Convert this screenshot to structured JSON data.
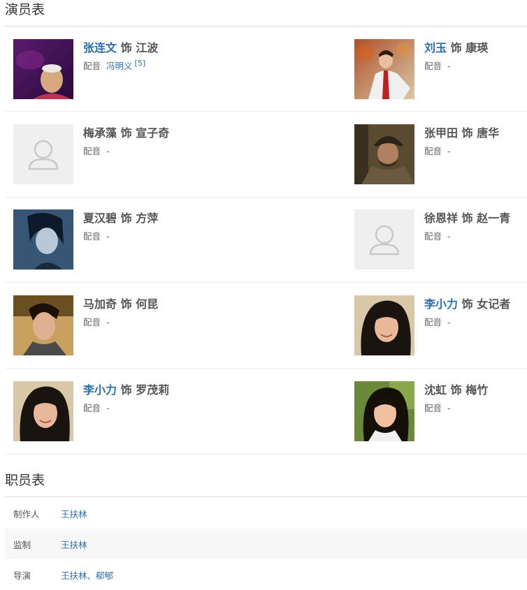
{
  "cast": {
    "title": "演员表",
    "voice_label": "配音",
    "role_sep": "饰",
    "members": [
      {
        "actor": "张连文",
        "role": "江波",
        "actor_link": true,
        "voice": "冯明义",
        "voice_link": true,
        "ref": "[5]",
        "photo": "photo"
      },
      {
        "actor": "刘玉",
        "role": "康瑛",
        "actor_link": true,
        "voice": "-",
        "voice_link": false,
        "ref": "",
        "photo": "photo"
      },
      {
        "actor": "梅承藻",
        "role": "宣子奇",
        "actor_link": false,
        "voice": "-",
        "voice_link": false,
        "ref": "",
        "photo": "placeholder-person-icon"
      },
      {
        "actor": "张甲田",
        "role": "唐华",
        "actor_link": false,
        "voice": "-",
        "voice_link": false,
        "ref": "",
        "photo": "photo"
      },
      {
        "actor": "夏汉碧",
        "role": "方萍",
        "actor_link": false,
        "voice": "-",
        "voice_link": false,
        "ref": "",
        "photo": "photo"
      },
      {
        "actor": "徐恩祥",
        "role": "赵一青",
        "actor_link": false,
        "voice": "-",
        "voice_link": false,
        "ref": "",
        "photo": "placeholder-person-icon"
      },
      {
        "actor": "马加奇",
        "role": "何昆",
        "actor_link": false,
        "voice": "-",
        "voice_link": false,
        "ref": "",
        "photo": "photo"
      },
      {
        "actor": "李小力",
        "role": "女记者",
        "actor_link": true,
        "voice": "-",
        "voice_link": false,
        "ref": "",
        "photo": "photo"
      },
      {
        "actor": "李小力",
        "role": "罗茂莉",
        "actor_link": true,
        "voice": "-",
        "voice_link": false,
        "ref": "",
        "photo": "photo"
      },
      {
        "actor": "沈虹",
        "role": "梅竹",
        "actor_link": false,
        "voice": "-",
        "voice_link": false,
        "ref": "",
        "photo": "photo"
      }
    ]
  },
  "crew": {
    "title": "职员表",
    "rows": [
      {
        "label": "制作人",
        "value": "王扶林"
      },
      {
        "label": "监制",
        "value": "王扶林"
      },
      {
        "label": "导演",
        "value": "王扶林、郗郇"
      }
    ]
  },
  "colors": {
    "link": "#2a6fb0",
    "placeholder_bg": "#efefef"
  }
}
